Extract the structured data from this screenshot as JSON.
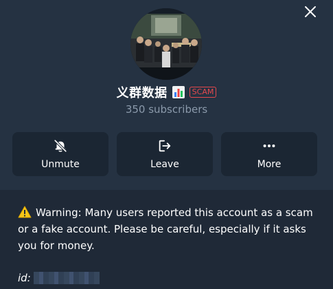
{
  "channel": {
    "title": "义群数据",
    "badge": "SCAM",
    "subscribers": "350 subscribers"
  },
  "actions": [
    {
      "label": "Unmute",
      "icon": "bell-off-icon"
    },
    {
      "label": "Leave",
      "icon": "leave-icon"
    },
    {
      "label": "More",
      "icon": "more-dots-icon"
    }
  ],
  "warning": {
    "text": "Warning: Many users reported this account as a scam or a fake account. Please be careful, especially if it asks you for money."
  },
  "id_label": "id:",
  "colors": {
    "background": "#1f2937",
    "header": "#253242",
    "button": "#1b2633",
    "scam": "#e5484d",
    "muted_text": "#8b9aab"
  }
}
